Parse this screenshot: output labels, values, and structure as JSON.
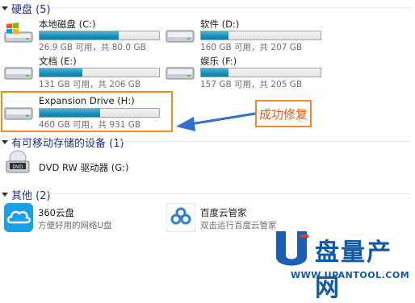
{
  "sections": {
    "hard_disks": {
      "label": "硬盘 (5)"
    },
    "removable": {
      "label": "有可移动存储的设备 (1)"
    },
    "other": {
      "label": "其他 (2)"
    }
  },
  "drives": [
    {
      "name": "本地磁盘 (C:)",
      "info": "26.9 GB 可用，共 80.0 GB",
      "used_fraction": 0.66
    },
    {
      "name": "软件 (D:)",
      "info": "160 GB 可用，共 207 GB",
      "used_fraction": 0.23
    },
    {
      "name": "文档 (E:)",
      "info": "131 GB 可用，共 206 GB",
      "used_fraction": 0.36
    },
    {
      "name": "娱乐 (F:)",
      "info": "157 GB 可用，共 205 GB",
      "used_fraction": 0.23
    },
    {
      "name": "Expansion Drive (H:)",
      "info": "460 GB 可用，共 931 GB",
      "used_fraction": 0.51
    }
  ],
  "dvd": {
    "name": "DVD RW 驱动器 (G:)",
    "badge": "DVD"
  },
  "apps": [
    {
      "name": "360云盘",
      "desc": "方便好用的网络U盘"
    },
    {
      "name": "百度云管家",
      "desc": "双击运行百度云管家"
    }
  ],
  "callout": {
    "text": "成功修复"
  },
  "watermark": {
    "text": "盘量产网",
    "url": "WWW.UPANTOOL.COM"
  },
  "colors": {
    "accent": "#f0892b",
    "bar": "#168eb6",
    "header": "#1e3287"
  }
}
